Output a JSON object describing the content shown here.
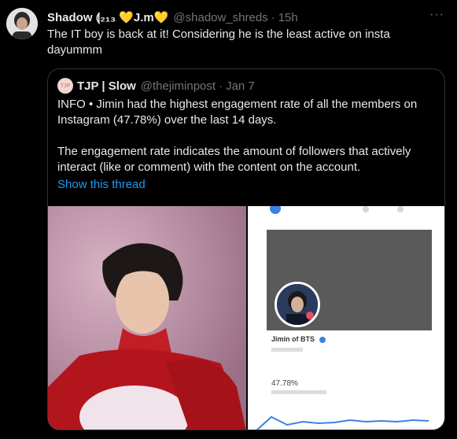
{
  "tweet": {
    "display_name": "Shadow ⟬₂₁₃ 💛J.m💛",
    "handle": "@shadow_shreds",
    "separator": "·",
    "time": "15h",
    "more_icon": "···",
    "text_line1": "The IT boy is back at it! Considering he is the least active on insta",
    "text_line2": "dayummm"
  },
  "quoted": {
    "avatar_text": "TJP",
    "display_name": "TJP | Slow",
    "handle": "@thejiminpost",
    "separator": "·",
    "date": "Jan 7",
    "paragraph1": "INFO • Jimin had the highest engagement rate of all the members on Instagram (47.78%) over the last 14 days.",
    "paragraph2": "The engagement rate indicates the amount of followers that actively interact (like or comment) with the content on the account.",
    "show_thread": "Show this thread",
    "link_color": "#1d9bf0"
  },
  "media_right": {
    "profile_name": "Jimin of BTS",
    "rate": "47.78%"
  },
  "colors": {
    "background": "#000000",
    "text": "#e7e9ea",
    "secondary": "#71767b",
    "border": "#2f3336"
  }
}
